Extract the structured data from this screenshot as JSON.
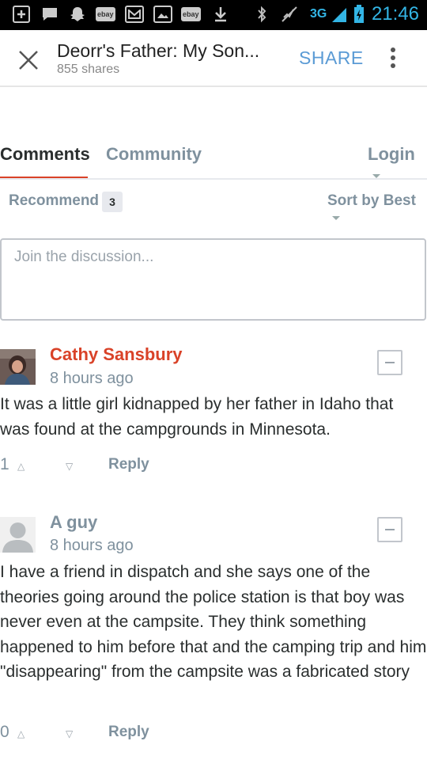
{
  "status_bar": {
    "time": "21:46",
    "network": "3G",
    "notification_icons": [
      "plus-square-icon",
      "message-icon",
      "snapchat-icon",
      "ebay-icon",
      "gmail-icon",
      "image-icon",
      "ebay-icon",
      "download-icon"
    ],
    "ebay_label": "ebay",
    "system_icons": [
      "bluetooth-icon",
      "mute-icon",
      "signal-icon",
      "battery-charging-icon"
    ]
  },
  "app_bar": {
    "title": "Deorr's Father: My Son...",
    "shares": "855 shares",
    "share_label": "SHARE"
  },
  "tabs": {
    "comments": "Comments",
    "community": "Community",
    "login": "Login"
  },
  "toolbar": {
    "recommend": "Recommend",
    "recommend_count": "3",
    "sort": "Sort by Best"
  },
  "composer": {
    "placeholder": "Join the discussion..."
  },
  "comments": [
    {
      "author": "Cathy Sansbury",
      "time": "8 hours ago",
      "text": "It was a little girl kidnapped by her father in Idaho that was found at the campgrounds in Minnesota.",
      "votes": "1",
      "reply": "Reply"
    },
    {
      "author": "A guy",
      "time": "8 hours ago",
      "text": "I have a friend in dispatch and she says one of the theories going around the police station is that boy was never even at the campsite. They think something happened to him before that and the camping trip and him \"disappearing\" from the campsite was a fabricated story",
      "votes": "0",
      "reply": "Reply"
    }
  ],
  "colors": {
    "accent_red": "#d94228",
    "muted": "#7f919e",
    "share_blue": "#5b9bd5",
    "status_blue": "#33b5e5"
  }
}
